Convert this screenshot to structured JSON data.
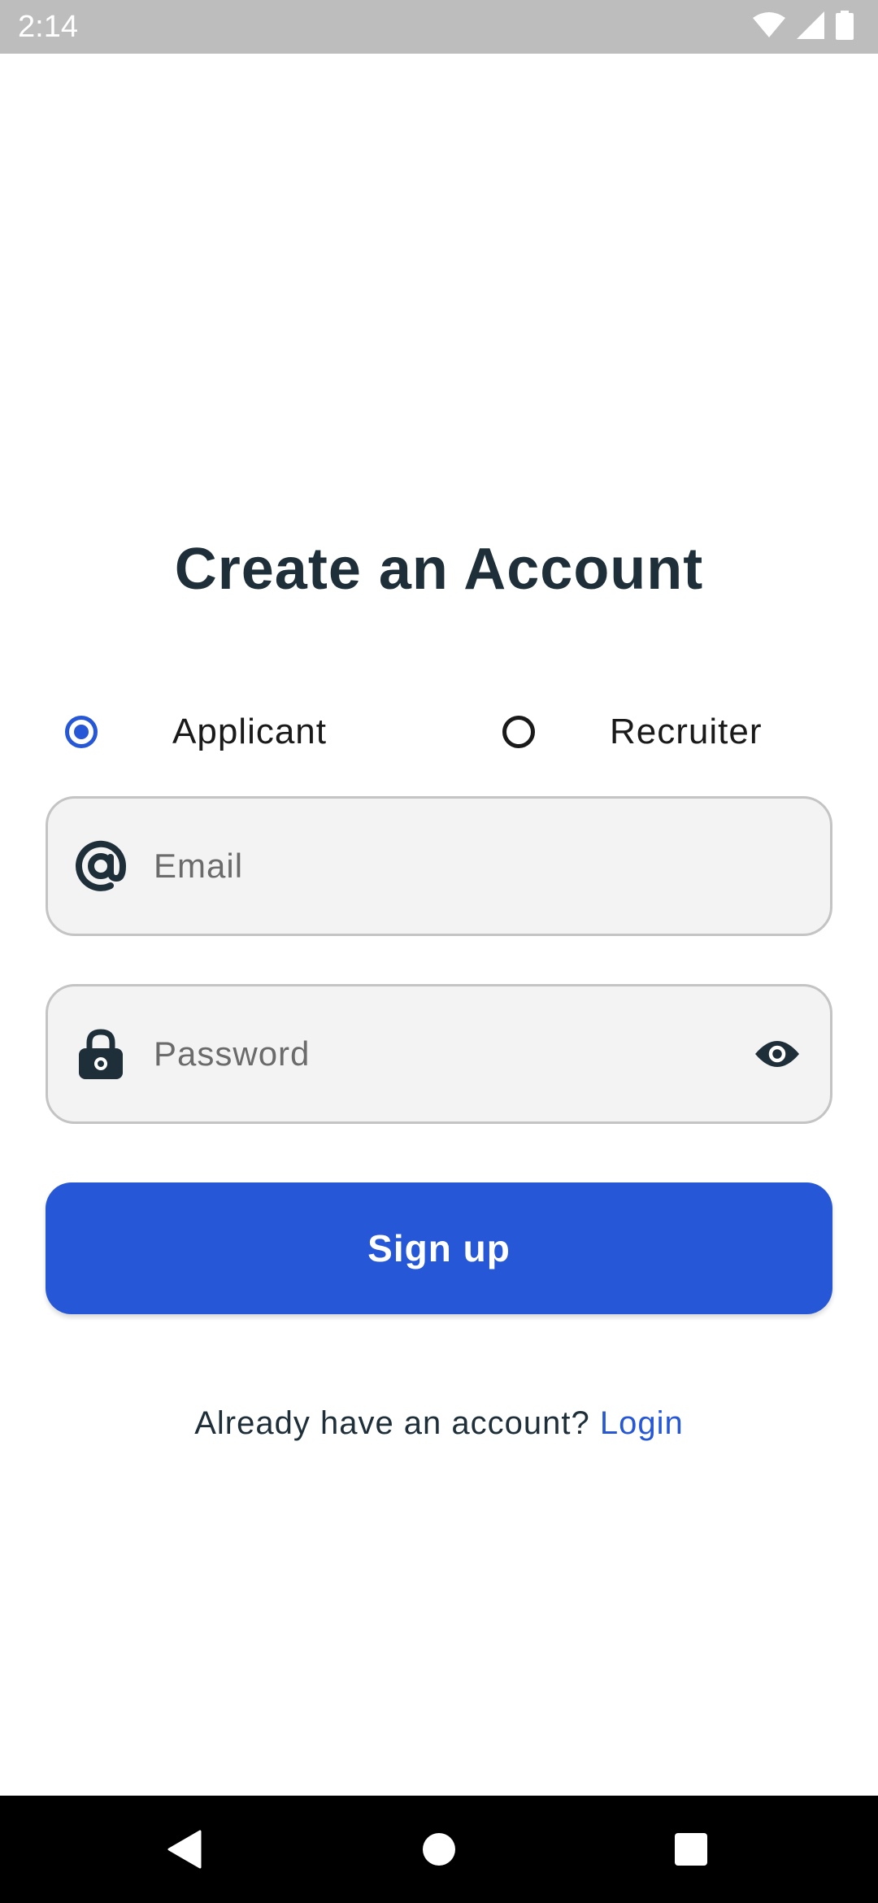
{
  "status_bar": {
    "time": "2:14",
    "icons": [
      "wifi-icon",
      "signal-icon",
      "battery-icon"
    ]
  },
  "title": "Create an Account",
  "account_type": {
    "options": [
      {
        "label": "Applicant",
        "selected": true
      },
      {
        "label": "Recruiter",
        "selected": false
      }
    ]
  },
  "email_field": {
    "icon": "at-sign-icon",
    "placeholder": "Email",
    "value": ""
  },
  "password_field": {
    "icon": "lock-icon",
    "placeholder": "Password",
    "value": "",
    "toggle_icon": "eye-icon"
  },
  "signup_button": {
    "label": "Sign up"
  },
  "login_prompt": {
    "text": "Already have an account?",
    "link_label": "Login"
  },
  "nav_bar": {
    "buttons": [
      "back-icon",
      "home-icon",
      "recents-icon"
    ]
  },
  "colors": {
    "primary": "#2557d6",
    "title": "#1e2f3a",
    "field_background": "#f3f3f3",
    "status_bar": "#bdbdbd"
  }
}
